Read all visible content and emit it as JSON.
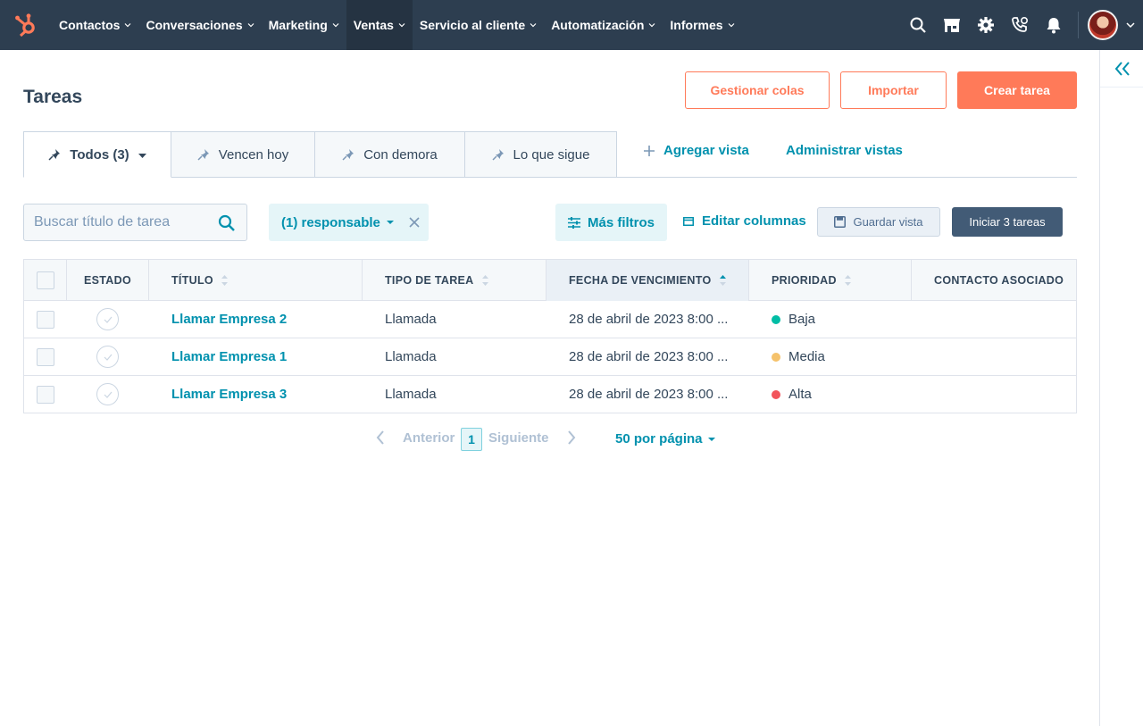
{
  "topnav": {
    "items": [
      {
        "label": "Contactos"
      },
      {
        "label": "Conversaciones"
      },
      {
        "label": "Marketing"
      },
      {
        "label": "Ventas",
        "active": true
      },
      {
        "label": "Servicio al cliente"
      },
      {
        "label": "Automatización"
      },
      {
        "label": "Informes"
      }
    ],
    "icons": [
      "search-icon",
      "marketplace-icon",
      "settings-icon",
      "calling-icon",
      "notifications-icon"
    ]
  },
  "page": {
    "title": "Tareas",
    "buttons": {
      "manage_queues": "Gestionar colas",
      "import": "Importar",
      "create_task": "Crear tarea"
    }
  },
  "tabs": [
    {
      "label": "Todos (3)",
      "active": true
    },
    {
      "label": "Vencen hoy"
    },
    {
      "label": "Con demora"
    },
    {
      "label": "Lo que sigue"
    }
  ],
  "view_actions": {
    "add_view": "Agregar vista",
    "manage_views": "Administrar vistas"
  },
  "filters": {
    "search_placeholder": "Buscar título de tarea",
    "owner_chip": "(1) responsable",
    "more_filters": "Más filtros",
    "edit_columns": "Editar columnas",
    "save_view": "Guardar vista",
    "start_tasks": "Iniciar 3 tareas"
  },
  "table": {
    "columns": [
      "ESTADO",
      "TÍTULO",
      "TIPO DE TAREA",
      "FECHA DE VENCIMIENTO",
      "PRIORIDAD",
      "CONTACTO ASOCIADO"
    ],
    "rows": [
      {
        "title": "Llamar Empresa 2",
        "type": "Llamada",
        "due": "28 de abril de 2023 8:00 ...",
        "priority": "Baja",
        "priority_color": "#00bda5",
        "contact": ""
      },
      {
        "title": "Llamar Empresa 1",
        "type": "Llamada",
        "due": "28 de abril de 2023 8:00 ...",
        "priority": "Media",
        "priority_color": "#f5c26b",
        "contact": ""
      },
      {
        "title": "Llamar Empresa 3",
        "type": "Llamada",
        "due": "28 de abril de 2023 8:00 ...",
        "priority": "Alta",
        "priority_color": "#f2545b",
        "contact": ""
      }
    ]
  },
  "pagination": {
    "prev": "Anterior",
    "page": "1",
    "next": "Siguiente",
    "per_page": "50 por página"
  },
  "colors": {
    "nav_bg": "#2d3e50",
    "accent": "#ff7a59",
    "link": "#0091ae"
  }
}
